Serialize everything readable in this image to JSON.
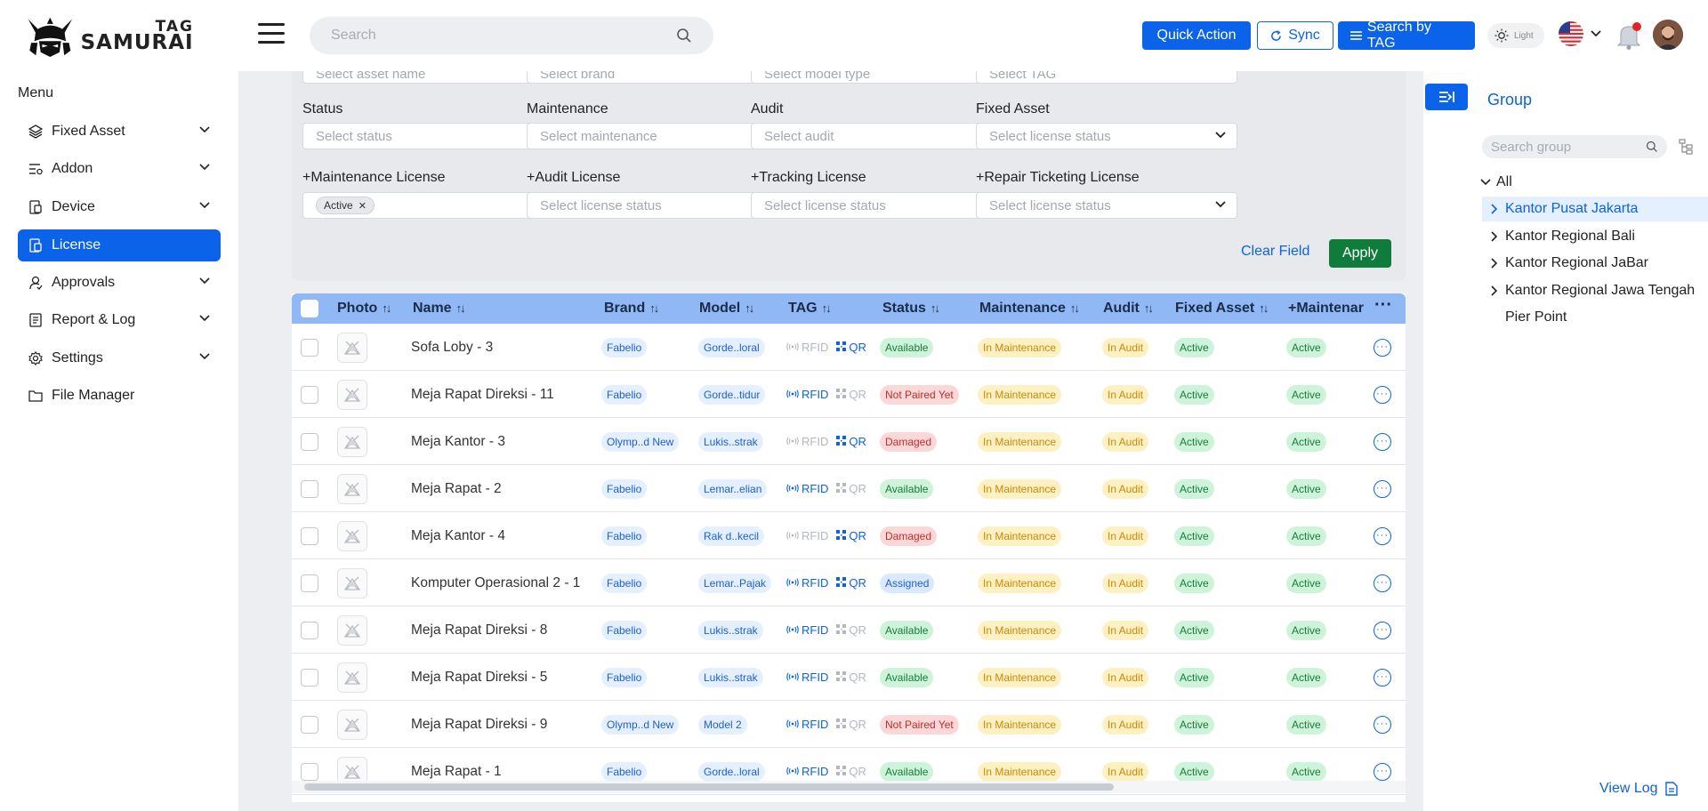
{
  "header": {
    "logo_top": "TAG",
    "logo_bottom": "SAMURAI",
    "search_placeholder": "Search",
    "quick_action": "Quick Action",
    "sync": "Sync",
    "search_by_tag": "Search by TAG",
    "theme_label": "Light"
  },
  "sidebar": {
    "menu_title": "Menu",
    "items": [
      {
        "label": "Fixed Asset",
        "icon": "layers-icon"
      },
      {
        "label": "Addon",
        "icon": "addon-icon"
      },
      {
        "label": "Device",
        "icon": "device-icon"
      },
      {
        "label": "License",
        "icon": "license-icon"
      },
      {
        "label": "Approvals",
        "icon": "approval-icon"
      },
      {
        "label": "Report & Log",
        "icon": "report-icon"
      },
      {
        "label": "Settings",
        "icon": "gear-icon"
      },
      {
        "label": "File Manager",
        "icon": "folder-icon"
      }
    ]
  },
  "filters": {
    "row0": [
      {
        "placeholder": "Select asset name"
      },
      {
        "placeholder": "Select brand"
      },
      {
        "placeholder": "Select model type"
      },
      {
        "placeholder": "Select TAG"
      }
    ],
    "row1": [
      {
        "label": "Status",
        "placeholder": "Select status"
      },
      {
        "label": "Maintenance",
        "placeholder": "Select maintenance"
      },
      {
        "label": "Audit",
        "placeholder": "Select audit"
      },
      {
        "label": "Fixed Asset",
        "placeholder": "Select license status"
      }
    ],
    "row2": [
      {
        "label": "+Maintenance License",
        "placeholder": ""
      },
      {
        "label": "+Audit License",
        "placeholder": "Select license status"
      },
      {
        "label": "+Tracking License",
        "placeholder": "Select license status"
      },
      {
        "label": "+Repair Ticketing License",
        "placeholder": "Select license status"
      }
    ],
    "active_chip": "Active",
    "clear_field": "Clear Field",
    "apply": "Apply"
  },
  "table": {
    "columns": [
      "Photo",
      "Name",
      "Brand",
      "Model",
      "TAG",
      "Status",
      "Maintenance",
      "Audit",
      "Fixed Asset",
      "+Maintenar"
    ],
    "rows": [
      {
        "name": "Sofa Loby - 3",
        "brand": "Fabelio",
        "model": "Gorde..loral",
        "rfid": false,
        "qr": true,
        "status": "Available",
        "maintenance": "In Maintenance",
        "audit": "In Audit",
        "fixed_asset": "Active",
        "maint_license": "Active"
      },
      {
        "name": "Meja Rapat Direksi - 11",
        "brand": "Fabelio",
        "model": "Gorde..tidur",
        "rfid": true,
        "qr": false,
        "status": "Not Paired Yet",
        "maintenance": "In Maintenance",
        "audit": "In Audit",
        "fixed_asset": "Active",
        "maint_license": "Active"
      },
      {
        "name": "Meja Kantor - 3",
        "brand": "Olymp..d New",
        "model": "Lukis..strak",
        "rfid": false,
        "qr": true,
        "status": "Damaged",
        "maintenance": "In Maintenance",
        "audit": "In Audit",
        "fixed_asset": "Active",
        "maint_license": "Active"
      },
      {
        "name": "Meja Rapat - 2",
        "brand": "Fabelio",
        "model": "Lemar..elian",
        "rfid": true,
        "qr": false,
        "status": "Available",
        "maintenance": "In Maintenance",
        "audit": "In Audit",
        "fixed_asset": "Active",
        "maint_license": "Active"
      },
      {
        "name": "Meja Kantor - 4",
        "brand": "Fabelio",
        "model": "Rak d..kecil",
        "rfid": false,
        "qr": true,
        "status": "Damaged",
        "maintenance": "In Maintenance",
        "audit": "In Audit",
        "fixed_asset": "Active",
        "maint_license": "Active"
      },
      {
        "name": "Komputer Operasional 2 - 1",
        "brand": "Fabelio",
        "model": "Lemar..Pajak",
        "rfid": true,
        "qr": true,
        "status": "Assigned",
        "maintenance": "In Maintenance",
        "audit": "In Audit",
        "fixed_asset": "Active",
        "maint_license": "Active"
      },
      {
        "name": "Meja Rapat Direksi - 8",
        "brand": "Fabelio",
        "model": "Lukis..strak",
        "rfid": true,
        "qr": false,
        "status": "Available",
        "maintenance": "In Maintenance",
        "audit": "In Audit",
        "fixed_asset": "Active",
        "maint_license": "Active"
      },
      {
        "name": "Meja Rapat Direksi - 5",
        "brand": "Fabelio",
        "model": "Lukis..strak",
        "rfid": true,
        "qr": false,
        "status": "Available",
        "maintenance": "In Maintenance",
        "audit": "In Audit",
        "fixed_asset": "Active",
        "maint_license": "Active"
      },
      {
        "name": "Meja Rapat Direksi - 9",
        "brand": "Olymp..d New",
        "model": "Model 2",
        "rfid": true,
        "qr": false,
        "status": "Not Paired Yet",
        "maintenance": "In Maintenance",
        "audit": "In Audit",
        "fixed_asset": "Active",
        "maint_license": "Active"
      },
      {
        "name": "Meja Rapat - 1",
        "brand": "Fabelio",
        "model": "Gorde..loral",
        "rfid": true,
        "qr": false,
        "status": "Available",
        "maintenance": "In Maintenance",
        "audit": "In Audit",
        "fixed_asset": "Active",
        "maint_license": "Active"
      }
    ],
    "tag_rfid": "RFID",
    "tag_qr": "QR"
  },
  "group": {
    "title": "Group",
    "search_placeholder": "Search group",
    "root": "All",
    "items": [
      "Kantor Pusat Jakarta",
      "Kantor Regional Bali",
      "Kantor Regional JaBar",
      "Kantor Regional Jawa Tengah",
      "Pier Point"
    ],
    "view_log": "View Log"
  },
  "colors": {
    "primary": "#0a63e8",
    "apply_green": "#107c3c",
    "table_header": "#8fb8f5"
  }
}
